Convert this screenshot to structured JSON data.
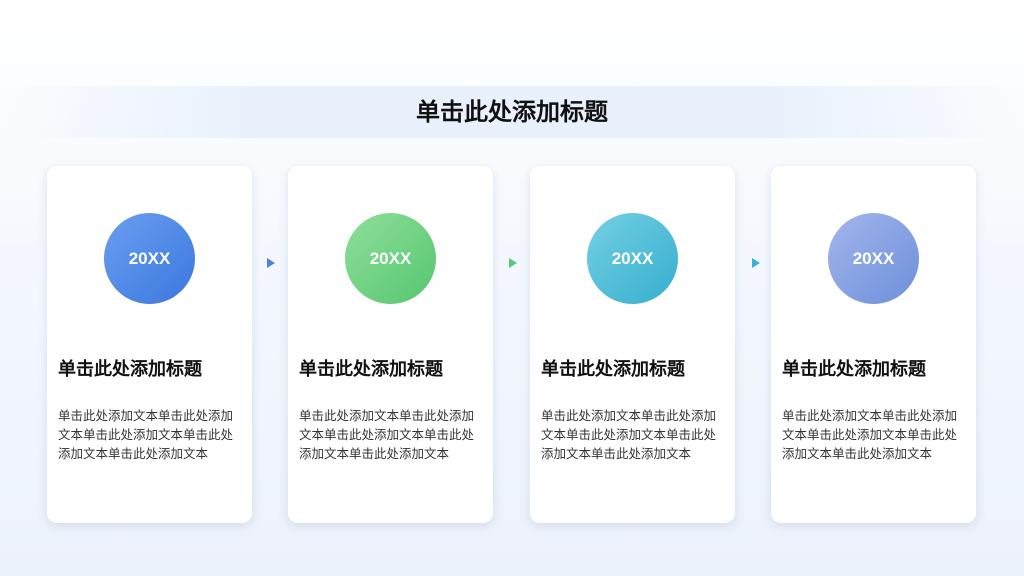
{
  "slide": {
    "title": "单击此处添加标题"
  },
  "cards": [
    {
      "year": "20XX",
      "title": "单击此处添加标题",
      "text": "单击此处添加文本单击此处添加文本单击此处添加文本单击此处添加文本单击此处添加文本",
      "color_from": "#6a9ef0",
      "color_to": "#3b78de"
    },
    {
      "year": "20XX",
      "title": "单击此处添加标题",
      "text": "单击此处添加文本单击此处添加文本单击此处添加文本单击此处添加文本单击此处添加文本",
      "color_from": "#8fdf9c",
      "color_to": "#55c66e"
    },
    {
      "year": "20XX",
      "title": "单击此处添加标题",
      "text": "单击此处添加文本单击此处添加文本单击此处添加文本单击此处添加文本单击此处添加文本",
      "color_from": "#76d0e2",
      "color_to": "#34aed0"
    },
    {
      "year": "20XX",
      "title": "单击此处添加标题",
      "text": "单击此处添加文本单击此处添加文本单击此处添加文本单击此处添加文本单击此处添加文本",
      "color_from": "#a3b6ec",
      "color_to": "#6d8fdb"
    }
  ],
  "arrows": [
    {
      "color": "#4a86e0"
    },
    {
      "color": "#5ac77a"
    },
    {
      "color": "#3ab0d6"
    }
  ]
}
